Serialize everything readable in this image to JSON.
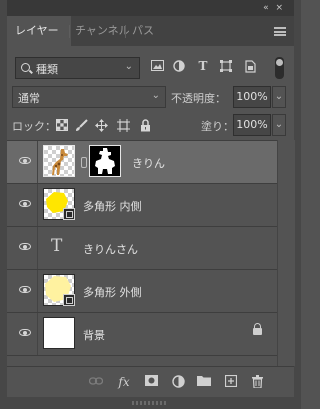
{
  "tabs": [
    {
      "label": "レイヤー",
      "active": true
    },
    {
      "label": "チャンネル",
      "active": false
    },
    {
      "label": "パス",
      "active": false
    }
  ],
  "collapse_glyph": "«",
  "close_glyph": "×",
  "filter": {
    "label": "種類",
    "icons": [
      "image-filter-icon",
      "adjustment-filter-icon",
      "type-filter-icon",
      "shape-filter-icon",
      "smart-object-filter-icon"
    ]
  },
  "blend": {
    "mode": "通常",
    "opacity_label": "不透明度：",
    "opacity_value": "100%"
  },
  "lock": {
    "label": "ロック：",
    "fill_label": "塗り：",
    "fill_value": "100%"
  },
  "layers": [
    {
      "name": "きりん",
      "type": "masked-image",
      "selected": true
    },
    {
      "name": "多角形 内側",
      "type": "shape",
      "selected": false
    },
    {
      "name": "きりんさん",
      "type": "text",
      "selected": false
    },
    {
      "name": "多角形 外側",
      "type": "shape",
      "selected": false
    },
    {
      "name": "背景",
      "type": "background",
      "selected": false,
      "locked": true
    }
  ],
  "text_layer_glyph": "T",
  "colors": {
    "panel": "#535353",
    "selected_row": "#6a6a6a",
    "shape_fill": "#ffe600",
    "shape_fill_light": "#fff2a0"
  }
}
